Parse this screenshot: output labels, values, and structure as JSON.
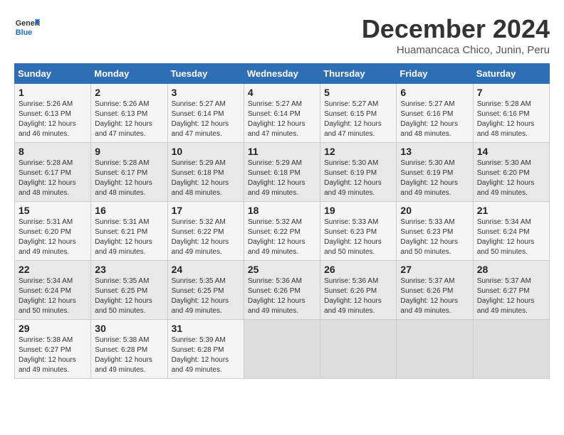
{
  "header": {
    "logo_line1": "General",
    "logo_line2": "Blue",
    "title": "December 2024",
    "location": "Huamancaca Chico, Junin, Peru"
  },
  "weekdays": [
    "Sunday",
    "Monday",
    "Tuesday",
    "Wednesday",
    "Thursday",
    "Friday",
    "Saturday"
  ],
  "weeks": [
    [
      {
        "day": "1",
        "sunrise": "Sunrise: 5:26 AM",
        "sunset": "Sunset: 6:13 PM",
        "daylight": "Daylight: 12 hours and 46 minutes."
      },
      {
        "day": "2",
        "sunrise": "Sunrise: 5:26 AM",
        "sunset": "Sunset: 6:13 PM",
        "daylight": "Daylight: 12 hours and 47 minutes."
      },
      {
        "day": "3",
        "sunrise": "Sunrise: 5:27 AM",
        "sunset": "Sunset: 6:14 PM",
        "daylight": "Daylight: 12 hours and 47 minutes."
      },
      {
        "day": "4",
        "sunrise": "Sunrise: 5:27 AM",
        "sunset": "Sunset: 6:14 PM",
        "daylight": "Daylight: 12 hours and 47 minutes."
      },
      {
        "day": "5",
        "sunrise": "Sunrise: 5:27 AM",
        "sunset": "Sunset: 6:15 PM",
        "daylight": "Daylight: 12 hours and 47 minutes."
      },
      {
        "day": "6",
        "sunrise": "Sunrise: 5:27 AM",
        "sunset": "Sunset: 6:16 PM",
        "daylight": "Daylight: 12 hours and 48 minutes."
      },
      {
        "day": "7",
        "sunrise": "Sunrise: 5:28 AM",
        "sunset": "Sunset: 6:16 PM",
        "daylight": "Daylight: 12 hours and 48 minutes."
      }
    ],
    [
      {
        "day": "8",
        "sunrise": "Sunrise: 5:28 AM",
        "sunset": "Sunset: 6:17 PM",
        "daylight": "Daylight: 12 hours and 48 minutes."
      },
      {
        "day": "9",
        "sunrise": "Sunrise: 5:28 AM",
        "sunset": "Sunset: 6:17 PM",
        "daylight": "Daylight: 12 hours and 48 minutes."
      },
      {
        "day": "10",
        "sunrise": "Sunrise: 5:29 AM",
        "sunset": "Sunset: 6:18 PM",
        "daylight": "Daylight: 12 hours and 48 minutes."
      },
      {
        "day": "11",
        "sunrise": "Sunrise: 5:29 AM",
        "sunset": "Sunset: 6:18 PM",
        "daylight": "Daylight: 12 hours and 49 minutes."
      },
      {
        "day": "12",
        "sunrise": "Sunrise: 5:30 AM",
        "sunset": "Sunset: 6:19 PM",
        "daylight": "Daylight: 12 hours and 49 minutes."
      },
      {
        "day": "13",
        "sunrise": "Sunrise: 5:30 AM",
        "sunset": "Sunset: 6:19 PM",
        "daylight": "Daylight: 12 hours and 49 minutes."
      },
      {
        "day": "14",
        "sunrise": "Sunrise: 5:30 AM",
        "sunset": "Sunset: 6:20 PM",
        "daylight": "Daylight: 12 hours and 49 minutes."
      }
    ],
    [
      {
        "day": "15",
        "sunrise": "Sunrise: 5:31 AM",
        "sunset": "Sunset: 6:20 PM",
        "daylight": "Daylight: 12 hours and 49 minutes."
      },
      {
        "day": "16",
        "sunrise": "Sunrise: 5:31 AM",
        "sunset": "Sunset: 6:21 PM",
        "daylight": "Daylight: 12 hours and 49 minutes."
      },
      {
        "day": "17",
        "sunrise": "Sunrise: 5:32 AM",
        "sunset": "Sunset: 6:22 PM",
        "daylight": "Daylight: 12 hours and 49 minutes."
      },
      {
        "day": "18",
        "sunrise": "Sunrise: 5:32 AM",
        "sunset": "Sunset: 6:22 PM",
        "daylight": "Daylight: 12 hours and 49 minutes."
      },
      {
        "day": "19",
        "sunrise": "Sunrise: 5:33 AM",
        "sunset": "Sunset: 6:23 PM",
        "daylight": "Daylight: 12 hours and 50 minutes."
      },
      {
        "day": "20",
        "sunrise": "Sunrise: 5:33 AM",
        "sunset": "Sunset: 6:23 PM",
        "daylight": "Daylight: 12 hours and 50 minutes."
      },
      {
        "day": "21",
        "sunrise": "Sunrise: 5:34 AM",
        "sunset": "Sunset: 6:24 PM",
        "daylight": "Daylight: 12 hours and 50 minutes."
      }
    ],
    [
      {
        "day": "22",
        "sunrise": "Sunrise: 5:34 AM",
        "sunset": "Sunset: 6:24 PM",
        "daylight": "Daylight: 12 hours and 50 minutes."
      },
      {
        "day": "23",
        "sunrise": "Sunrise: 5:35 AM",
        "sunset": "Sunset: 6:25 PM",
        "daylight": "Daylight: 12 hours and 50 minutes."
      },
      {
        "day": "24",
        "sunrise": "Sunrise: 5:35 AM",
        "sunset": "Sunset: 6:25 PM",
        "daylight": "Daylight: 12 hours and 49 minutes."
      },
      {
        "day": "25",
        "sunrise": "Sunrise: 5:36 AM",
        "sunset": "Sunset: 6:26 PM",
        "daylight": "Daylight: 12 hours and 49 minutes."
      },
      {
        "day": "26",
        "sunrise": "Sunrise: 5:36 AM",
        "sunset": "Sunset: 6:26 PM",
        "daylight": "Daylight: 12 hours and 49 minutes."
      },
      {
        "day": "27",
        "sunrise": "Sunrise: 5:37 AM",
        "sunset": "Sunset: 6:26 PM",
        "daylight": "Daylight: 12 hours and 49 minutes."
      },
      {
        "day": "28",
        "sunrise": "Sunrise: 5:37 AM",
        "sunset": "Sunset: 6:27 PM",
        "daylight": "Daylight: 12 hours and 49 minutes."
      }
    ],
    [
      {
        "day": "29",
        "sunrise": "Sunrise: 5:38 AM",
        "sunset": "Sunset: 6:27 PM",
        "daylight": "Daylight: 12 hours and 49 minutes."
      },
      {
        "day": "30",
        "sunrise": "Sunrise: 5:38 AM",
        "sunset": "Sunset: 6:28 PM",
        "daylight": "Daylight: 12 hours and 49 minutes."
      },
      {
        "day": "31",
        "sunrise": "Sunrise: 5:39 AM",
        "sunset": "Sunset: 6:28 PM",
        "daylight": "Daylight: 12 hours and 49 minutes."
      },
      null,
      null,
      null,
      null
    ]
  ]
}
